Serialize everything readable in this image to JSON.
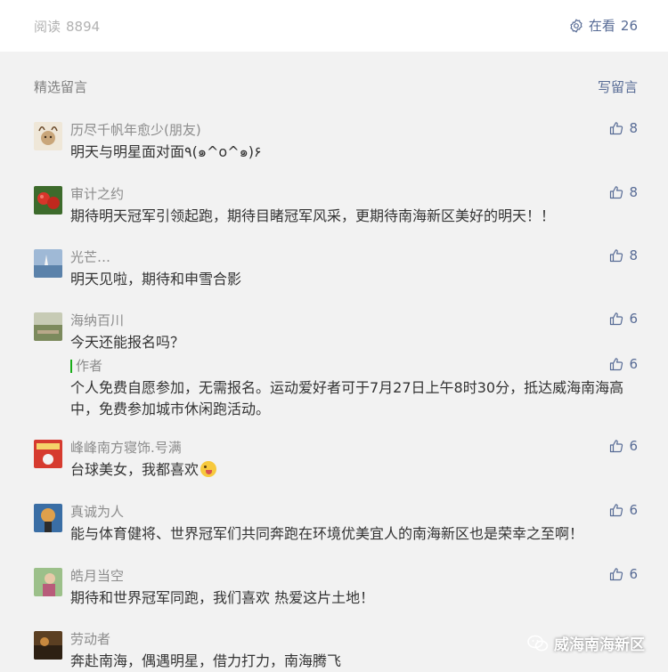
{
  "header": {
    "read_label": "阅读",
    "read_count": "8894",
    "watching_label": "在看",
    "watching_count": "26"
  },
  "section": {
    "title": "精选留言",
    "write_label": "写留言"
  },
  "comments": [
    {
      "nickname": "历尽千帆年愈少(朋友)",
      "content": "明天与明星面对面٩(๑^o^๑)۶",
      "likes": "8",
      "avatar_color": "#e9dcc9"
    },
    {
      "nickname": "审计之约",
      "content": "期待明天冠军引领起跑，期待目睹冠军风采，更期待南海新区美好的明天！！",
      "likes": "8",
      "avatar_color": "#c0392b"
    },
    {
      "nickname": "光芒…",
      "content": "明天见啦，期待和申雪合影",
      "likes": "8",
      "avatar_color": "#6d8fb3"
    },
    {
      "nickname": "海纳百川",
      "content": "今天还能报名吗？",
      "likes": "6",
      "avatar_color": "#8d9a72",
      "reply": {
        "name": "作者",
        "likes": "6",
        "text": "个人免费自愿参加，无需报名。运动爱好者可于7月27日上午8时30分，抵达威海南海高中，免费参加城市休闲跑活动。"
      }
    },
    {
      "nickname": "峰峰南方寝饰.号满",
      "content": "台球美女，我都喜欢",
      "likes": "6",
      "avatar_color": "#d63b2f",
      "emoji": "tongue-out-emoji"
    },
    {
      "nickname": "真诚为人",
      "content": "能与体育健将、世界冠军们共同奔跑在环境优美宜人的南海新区也是荣幸之至啊！",
      "likes": "6",
      "avatar_color": "#3a6ea5"
    },
    {
      "nickname": "皓月当空",
      "content": "期待和世界冠军同跑，我们喜欢  热爱这片土地！",
      "likes": "6",
      "avatar_color": "#7aa36b"
    },
    {
      "nickname": "劳动者",
      "content": "奔赴南海，偶遇明星，借力打力，南海腾飞",
      "likes": "",
      "avatar_color": "#5b3f22"
    }
  ],
  "watermark": {
    "text": "威海南海新区",
    "icon": "wechat-icon"
  },
  "colors": {
    "link": "#576b95",
    "author_bar": "#1aad19",
    "background": "#f2f2f2"
  }
}
